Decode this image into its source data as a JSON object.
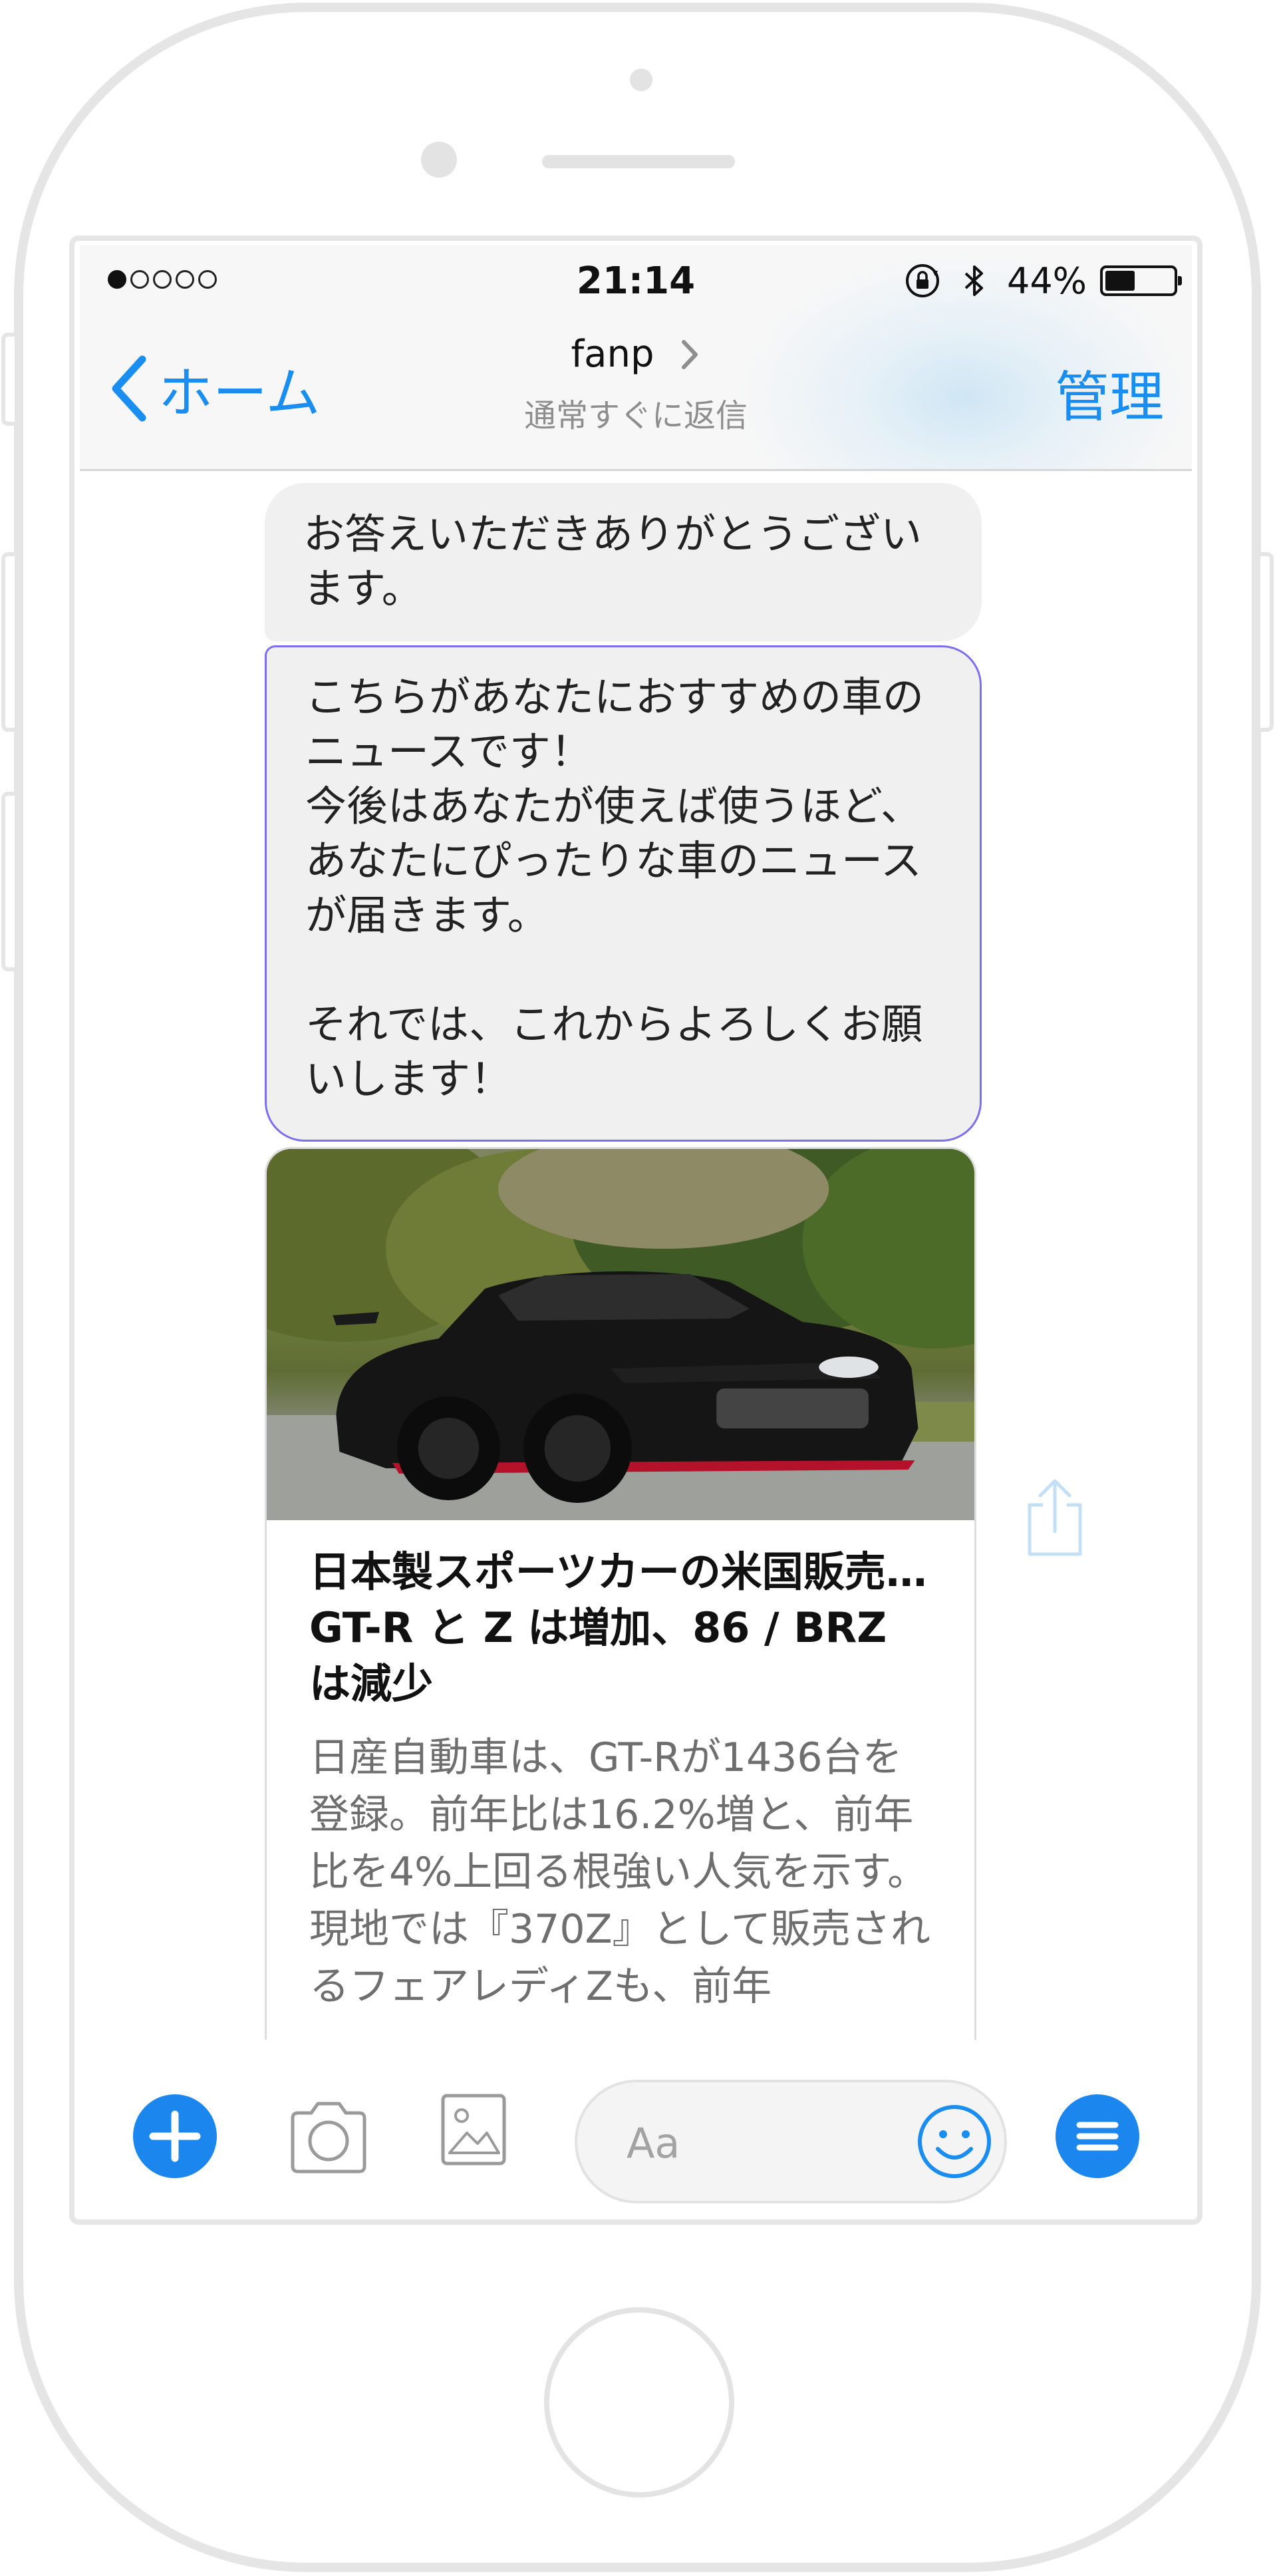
{
  "status_bar": {
    "time": "21:14",
    "battery_percent": "44%",
    "battery_level": 0.44,
    "signal_bars_on": 1,
    "signal_bars_total": 5
  },
  "nav": {
    "back_label": "ホーム",
    "title": "fanp",
    "subtitle": "通常すぐに返信",
    "manage_label": "管理"
  },
  "messages": [
    {
      "text": "お答えいただきありがとうございます。"
    },
    {
      "text": "こちらがあなたにおすすめの車のニュースです！\n今後はあなたが使えば使うほど、あなたにぴったりな車のニュースが届きます。\n\nそれでは、これからよろしくお願いします！"
    }
  ],
  "news_card": {
    "title": "日本製スポーツカーの米国販売…GT-R と Z は増加、86 / BRZ は減少",
    "description": "日産自動車は、GT-Rが1436台を登録。前年比は16.2%増と、前年比を4%上回る根強い人気を示す。現地では『370Z』として販売されるフェアレディZも、前年"
  },
  "composer": {
    "placeholder": "Aa"
  },
  "colors": {
    "accent": "#1a8ef0",
    "bubble": "#f1f0f0",
    "highlight_border": "#7b6ef0"
  },
  "icons": {
    "back": "chevron-left-icon",
    "title_chevron": "chevron-right-icon",
    "share": "share-icon",
    "plus": "plus-icon",
    "camera": "camera-icon",
    "photo": "photo-icon",
    "emoji": "smiley-icon",
    "menu": "menu-icon",
    "rotation_lock": "rotation-lock-icon",
    "bluetooth": "bluetooth-icon"
  }
}
